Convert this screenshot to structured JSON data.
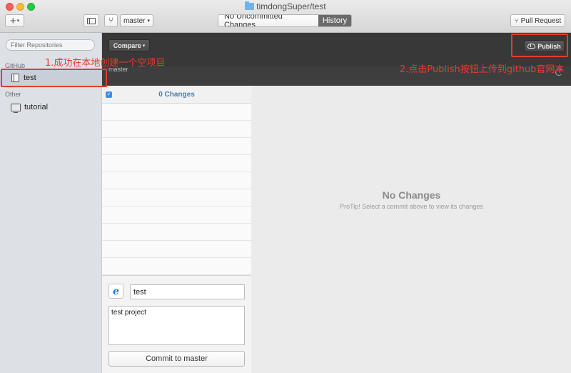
{
  "window": {
    "title": "timdongSuper/test"
  },
  "toolbar": {
    "add_label": "+",
    "branch_name": "master",
    "segments": {
      "uncommitted": "No Uncommitted Changes",
      "history": "History"
    },
    "pull_request_label": "Pull Request"
  },
  "sidebar": {
    "filter_placeholder": "Filter Repositories",
    "sections": [
      {
        "label": "GitHub",
        "items": [
          "test"
        ]
      },
      {
        "label": "Other",
        "items": [
          "tutorial"
        ]
      }
    ]
  },
  "header": {
    "compare_label": "Compare",
    "branch_label": "master",
    "publish_label": "Publish"
  },
  "changes": {
    "count_label": "0 Changes"
  },
  "commit": {
    "avatar_glyph": "e",
    "summary": "test",
    "description": "test project",
    "commit_button": "Commit to master"
  },
  "main": {
    "empty_title": "No Changes",
    "empty_tip": "ProTip! Select a commit above to view its changes"
  },
  "annotations": {
    "step1": "1.成功在本地创建一个空项目",
    "step2": "2.点击Publish按钮上传到github官网本"
  },
  "colors": {
    "annotation": "#e43d2e",
    "accent": "#3b8ee8"
  }
}
